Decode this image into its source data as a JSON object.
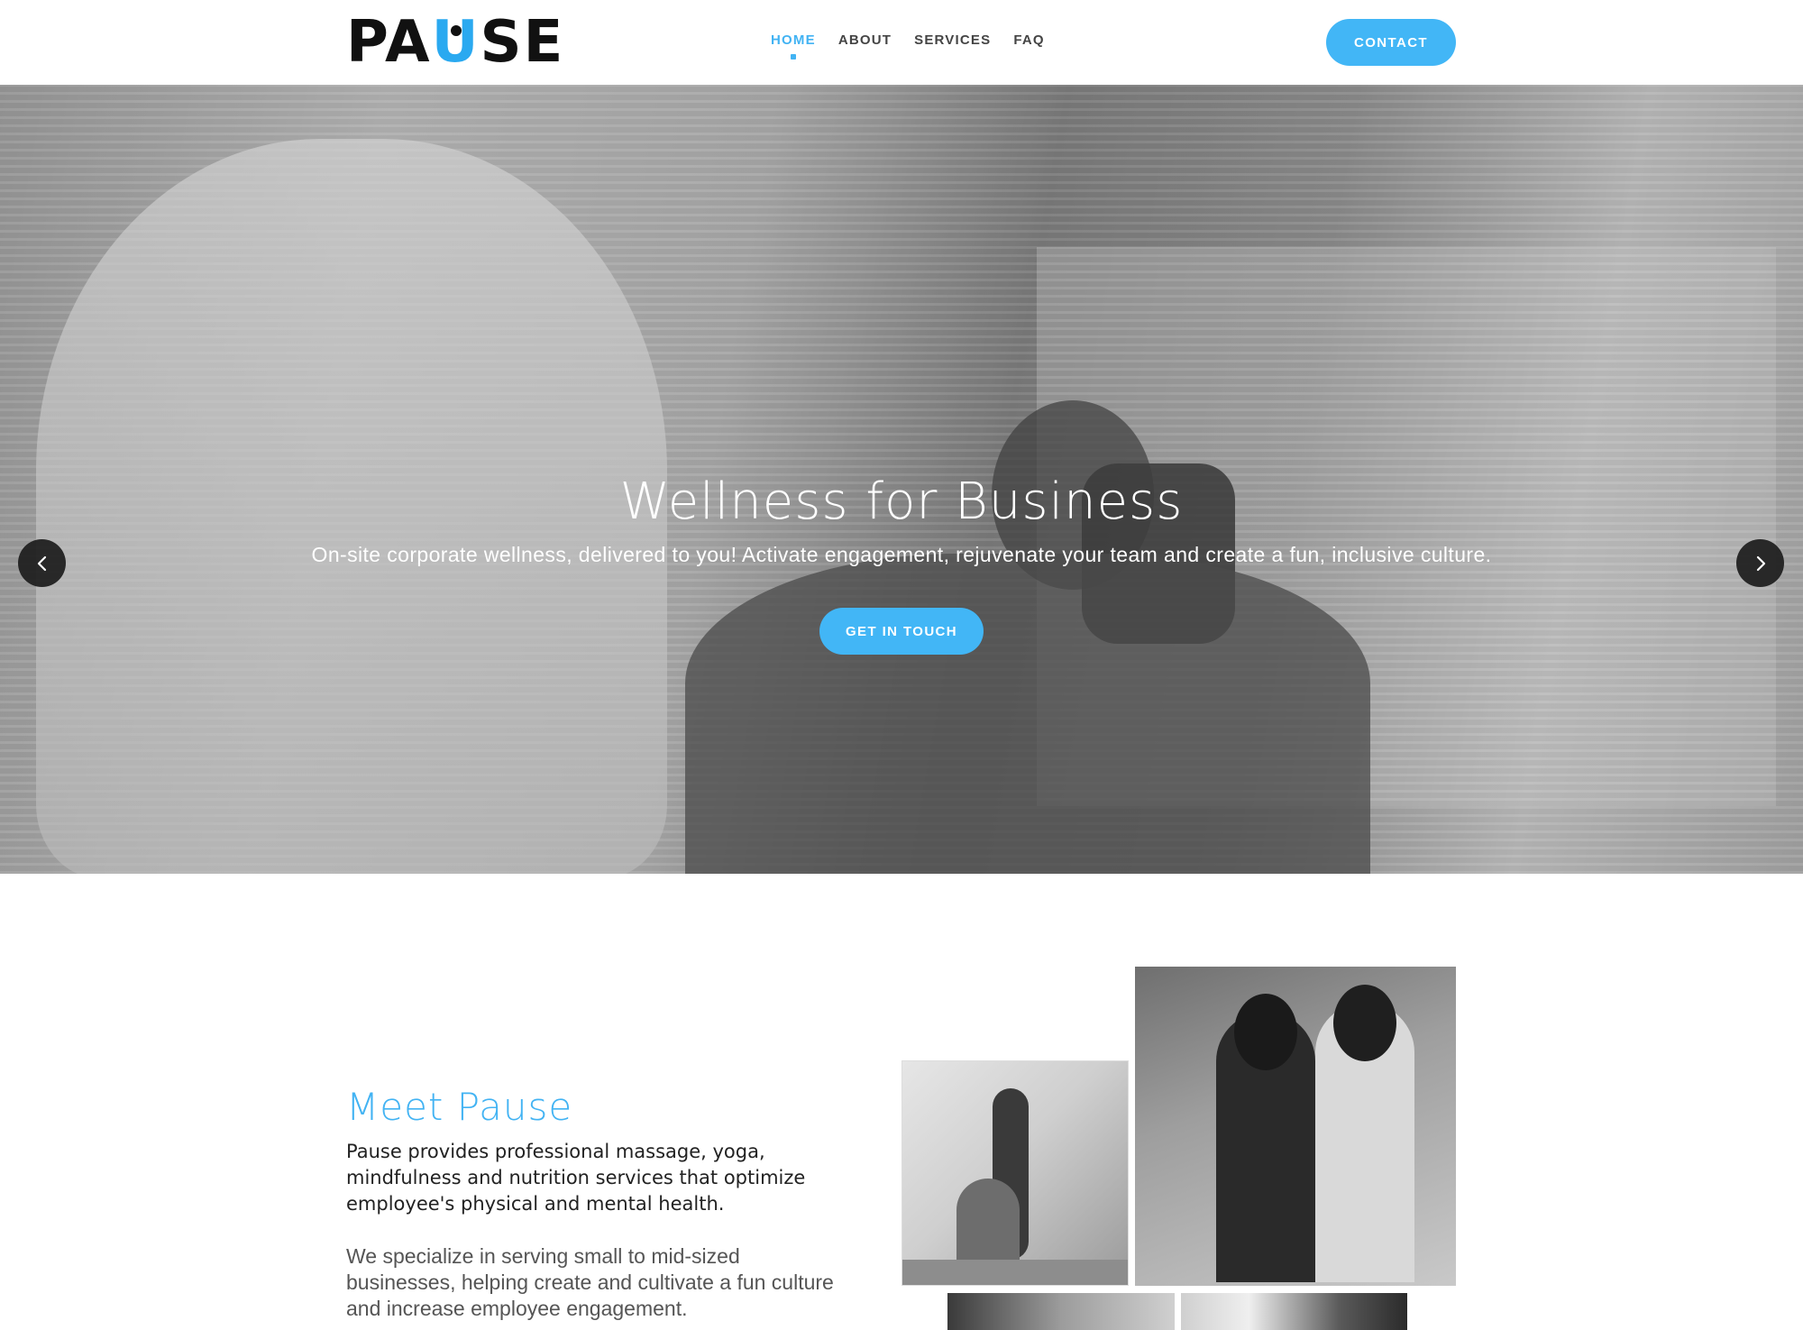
{
  "header": {
    "logo_text": "PAUSE",
    "logo_pre": "PA",
    "logo_u": "U",
    "logo_post": "SE",
    "nav": [
      {
        "label": "HOME",
        "active": true
      },
      {
        "label": "ABOUT",
        "active": false
      },
      {
        "label": "SERVICES",
        "active": false
      },
      {
        "label": "FAQ",
        "active": false
      }
    ],
    "contact_label": "CONTACT"
  },
  "hero": {
    "title": "Wellness for Business",
    "subtitle": "On-site corporate wellness, delivered to you! Activate engagement, rejuvenate your team and create a fun, inclusive culture.",
    "cta_label": "GET IN TOUCH",
    "prev_icon": "chevron-left-icon",
    "next_icon": "chevron-right-icon"
  },
  "meet": {
    "title": "Meet Pause",
    "paragraph1": "Pause provides professional massage, yoga, mindfulness and nutrition services that optimize employee's physical and mental health.",
    "paragraph2": "We specialize in serving small to mid-sized businesses, helping create and cultivate a fun culture and increase employee engagement."
  },
  "colors": {
    "accent": "#42b6f6",
    "text_dark": "#222222",
    "arrow_bg": "#1c1c1c"
  }
}
